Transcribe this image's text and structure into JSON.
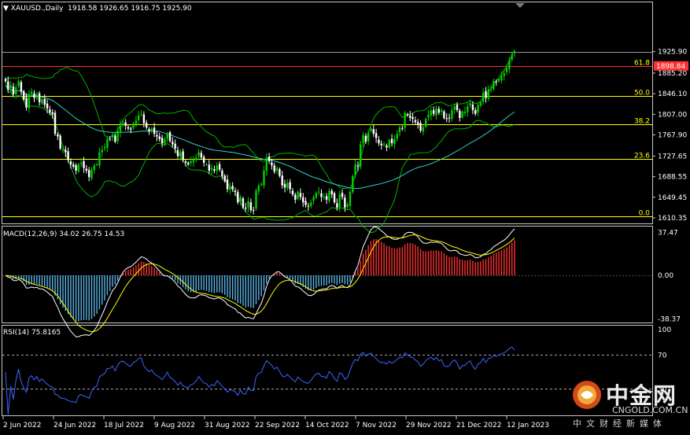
{
  "header": {
    "symbol": "XAUUSD.,Daily",
    "ohlc": "1918.58 1926.65 1916.75 1925.90",
    "macd_label": "MACD(12,26,9) 34.02 26.75 14.53",
    "rsi_label": "RSI(14) 75.8165"
  },
  "colors": {
    "background": "#000000",
    "bull": "#00d000",
    "bear": "#ffffff",
    "fib": "#ffff00",
    "bollinger": "#00b000",
    "ma": "#30d0d0",
    "current_line": "#ff3030",
    "macd_pos": "#ff3030",
    "macd_neg": "#5ab4e6",
    "rsi": "#3c64ff",
    "axis_text": "#ffffff"
  },
  "logo": {
    "name": "中金网",
    "url": "CNGOLD.COM.CN",
    "sub": "中文财经新媒体"
  },
  "chart_data": [
    {
      "type": "candlestick",
      "ylim": [
        1600,
        1940
      ],
      "y_ticks": [
        "1925.90",
        "1885.20",
        "1846.10",
        "1807.00",
        "1767.90",
        "1727.65",
        "1688.55",
        "1649.45",
        "1610.35"
      ],
      "current_price": "1898.84",
      "fibonacci": [
        {
          "label": "61.8",
          "price": 1898.84
        },
        {
          "label": "50.0",
          "price": 1842.0
        },
        {
          "label": "38.2",
          "price": 1788.0
        },
        {
          "label": "23.6",
          "price": 1722.0
        },
        {
          "label": "0.0",
          "price": 1614.0
        }
      ],
      "x_labels": [
        "2 Jun 2022",
        "24 Jun 2022",
        "18 Jul 2022",
        "9 Aug 2022",
        "31 Aug 2022",
        "22 Sep 2022",
        "14 Oct 2022",
        "7 Nov 2022",
        "29 Nov 2022",
        "21 Dec 2022",
        "12 Jan 2023"
      ],
      "closes": [
        1870,
        1855,
        1862,
        1845,
        1858,
        1870,
        1850,
        1835,
        1820,
        1845,
        1850,
        1838,
        1845,
        1830,
        1836,
        1825,
        1818,
        1810,
        1807,
        1770,
        1765,
        1742,
        1740,
        1735,
        1720,
        1712,
        1708,
        1700,
        1712,
        1715,
        1705,
        1700,
        1688,
        1702,
        1710,
        1712,
        1735,
        1740,
        1745,
        1760,
        1760,
        1768,
        1755,
        1775,
        1788,
        1790,
        1785,
        1780,
        1778,
        1790,
        1795,
        1805,
        1808,
        1790,
        1782,
        1775,
        1780,
        1770,
        1765,
        1760,
        1752,
        1760,
        1770,
        1756,
        1750,
        1742,
        1728,
        1735,
        1720,
        1715,
        1712,
        1718,
        1720,
        1725,
        1735,
        1725,
        1715,
        1712,
        1700,
        1705,
        1700,
        1710,
        1702,
        1690,
        1680,
        1665,
        1670,
        1665,
        1660,
        1640,
        1650,
        1630,
        1628,
        1642,
        1625,
        1625,
        1662,
        1672,
        1675,
        1700,
        1725,
        1718,
        1710,
        1698,
        1705,
        1690,
        1672,
        1668,
        1677,
        1665,
        1655,
        1645,
        1660,
        1650,
        1640,
        1635,
        1632,
        1640,
        1650,
        1658,
        1660,
        1650,
        1650,
        1645,
        1662,
        1655,
        1640,
        1630,
        1655,
        1650,
        1630,
        1636,
        1660,
        1690,
        1712,
        1708,
        1750,
        1768,
        1755,
        1772,
        1780,
        1770,
        1762,
        1752,
        1748,
        1750,
        1744,
        1758,
        1752,
        1760,
        1770,
        1782,
        1780,
        1810,
        1805,
        1800,
        1798,
        1792,
        1788,
        1776,
        1783,
        1798,
        1806,
        1814,
        1808,
        1818,
        1810,
        1815,
        1800,
        1798,
        1800,
        1815,
        1822,
        1815,
        1800,
        1812,
        1812,
        1822,
        1828,
        1815,
        1808,
        1825,
        1830,
        1848,
        1838,
        1855,
        1858,
        1870,
        1868,
        1874,
        1880,
        1885,
        1895,
        1910,
        1920,
        1925.9
      ]
    },
    {
      "type": "macd",
      "label": "MACD(12,26,9) 34.02 26.75 14.53",
      "values": {
        "macd": 34.02,
        "signal": 26.75,
        "histogram": 14.53
      },
      "y_ticks": [
        "37.47",
        "0.00",
        "-38.37"
      ],
      "ylim": [
        -38.37,
        37.47
      ]
    },
    {
      "type": "rsi",
      "label": "RSI(14) 75.8165",
      "value": 75.8165,
      "levels": [
        70,
        30
      ],
      "y_ticks": [
        "100",
        "70",
        "30"
      ],
      "ylim": [
        0,
        100
      ]
    }
  ]
}
